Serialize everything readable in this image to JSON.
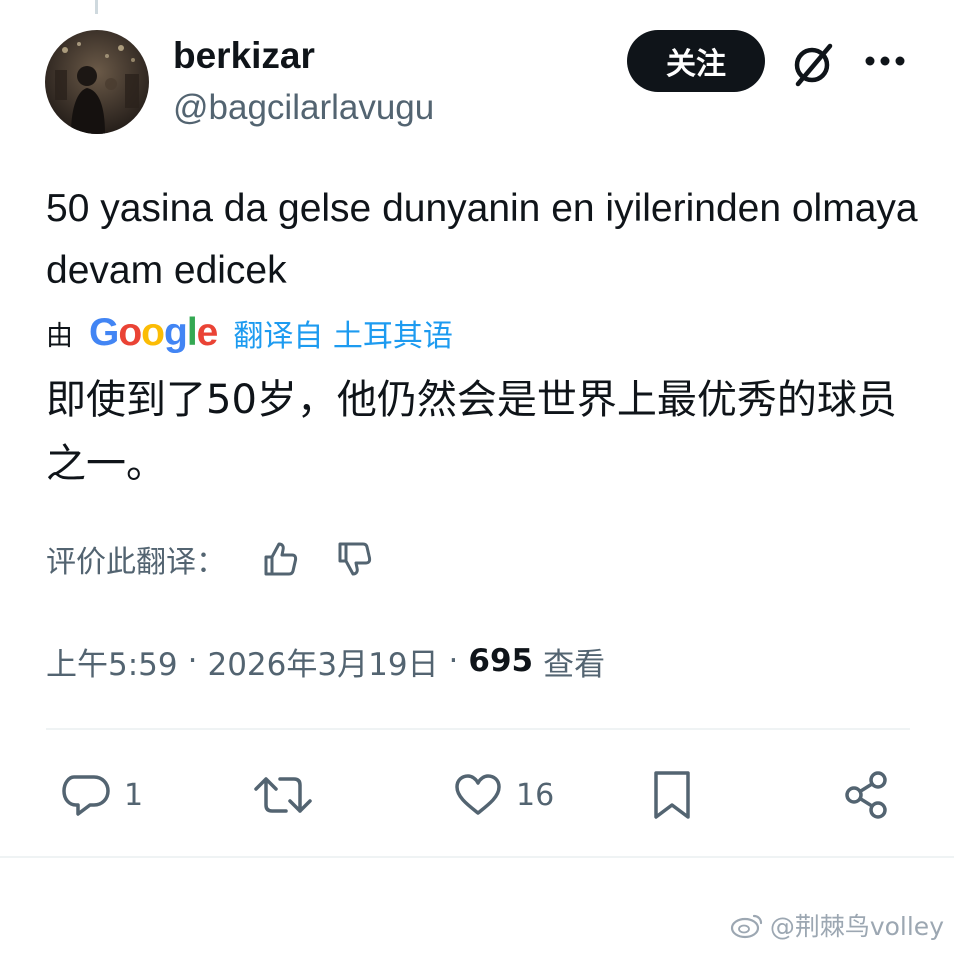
{
  "author": {
    "display_name": "berkizar",
    "handle": "@bagcilarlavugu"
  },
  "header": {
    "follow_label": "关注"
  },
  "tweet": {
    "text": "50 yasina da gelse dunyanin en iyilerinden olmaya devam edicek"
  },
  "translation": {
    "by_label": "由",
    "google_logo": "Google",
    "from_label": "翻译自 土耳其语",
    "text": "即使到了50岁，他仍然会是世界上最优秀的球员之一。",
    "rate_label": "评价此翻译："
  },
  "meta": {
    "time": "上午5:59",
    "separator": "·",
    "date": "2026年3月19日",
    "views_count": "695",
    "views_label": "查看"
  },
  "actions": {
    "reply_count": "1",
    "like_count": "16"
  },
  "watermark": {
    "text": "@荆棘鸟volley"
  },
  "colors": {
    "accent": "#1d9bf0",
    "text_primary": "#0f1419",
    "text_secondary": "#536471",
    "follow_bg": "#0f1419",
    "divider": "#eff3f4"
  },
  "icons": [
    "avatar-photo",
    "grok-icon",
    "more-icon",
    "thumbs-up-icon",
    "thumbs-down-icon",
    "reply-icon",
    "retweet-icon",
    "like-icon",
    "bookmark-icon",
    "share-icon",
    "weibo-icon"
  ]
}
